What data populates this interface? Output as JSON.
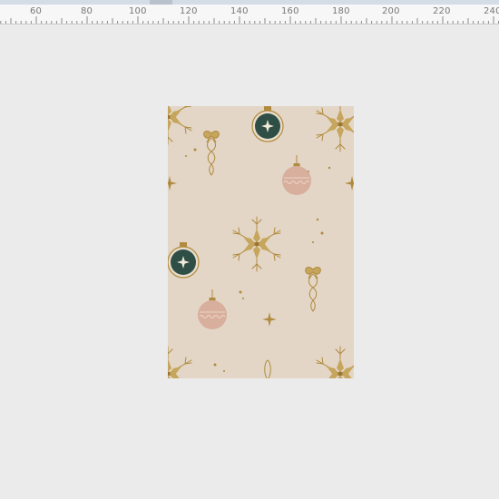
{
  "ruler": {
    "labels": [
      "60",
      "80",
      "100",
      "120",
      "140",
      "160",
      "180",
      "200",
      "220",
      "240"
    ]
  },
  "canvas": {
    "background_color": "#e3d6c6",
    "accent_gold": "#b08a3e",
    "ornament_green": "#2f4f46",
    "ornament_pink": "#d8ae9d",
    "motifs": [
      "snowflake-icon",
      "green-ornament-icon",
      "pink-ornament-icon",
      "bow-ornament-icon",
      "sparkle-icon"
    ]
  }
}
